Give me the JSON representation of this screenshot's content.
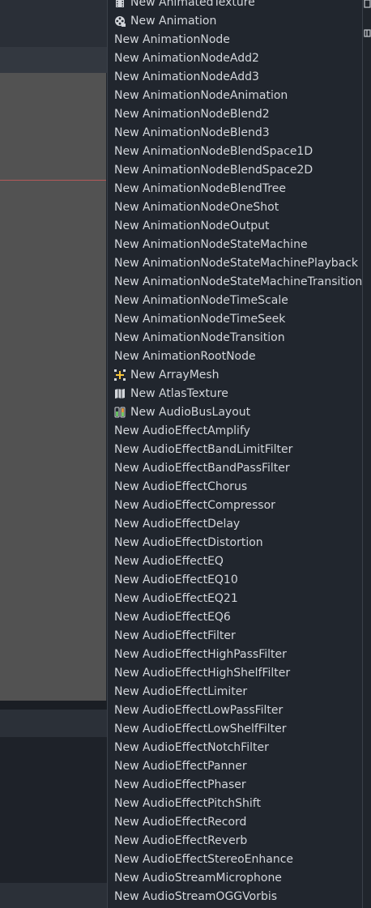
{
  "menu": {
    "items": [
      {
        "label": "New AnimatedTexture",
        "icon": "film-icon"
      },
      {
        "label": "New Animation",
        "icon": "animation-icon"
      },
      {
        "label": "New AnimationNode",
        "icon": ""
      },
      {
        "label": "New AnimationNodeAdd2",
        "icon": ""
      },
      {
        "label": "New AnimationNodeAdd3",
        "icon": ""
      },
      {
        "label": "New AnimationNodeAnimation",
        "icon": ""
      },
      {
        "label": "New AnimationNodeBlend2",
        "icon": ""
      },
      {
        "label": "New AnimationNodeBlend3",
        "icon": ""
      },
      {
        "label": "New AnimationNodeBlendSpace1D",
        "icon": ""
      },
      {
        "label": "New AnimationNodeBlendSpace2D",
        "icon": ""
      },
      {
        "label": "New AnimationNodeBlendTree",
        "icon": ""
      },
      {
        "label": "New AnimationNodeOneShot",
        "icon": ""
      },
      {
        "label": "New AnimationNodeOutput",
        "icon": ""
      },
      {
        "label": "New AnimationNodeStateMachine",
        "icon": ""
      },
      {
        "label": "New AnimationNodeStateMachinePlayback",
        "icon": ""
      },
      {
        "label": "New AnimationNodeStateMachineTransition",
        "icon": ""
      },
      {
        "label": "New AnimationNodeTimeScale",
        "icon": ""
      },
      {
        "label": "New AnimationNodeTimeSeek",
        "icon": ""
      },
      {
        "label": "New AnimationNodeTransition",
        "icon": ""
      },
      {
        "label": "New AnimationRootNode",
        "icon": ""
      },
      {
        "label": "New ArrayMesh",
        "icon": "array-mesh-icon"
      },
      {
        "label": "New AtlasTexture",
        "icon": "atlas-map-icon"
      },
      {
        "label": "New AudioBusLayout",
        "icon": "audio-bus-icon"
      },
      {
        "label": "New AudioEffectAmplify",
        "icon": ""
      },
      {
        "label": "New AudioEffectBandLimitFilter",
        "icon": ""
      },
      {
        "label": "New AudioEffectBandPassFilter",
        "icon": ""
      },
      {
        "label": "New AudioEffectChorus",
        "icon": ""
      },
      {
        "label": "New AudioEffectCompressor",
        "icon": ""
      },
      {
        "label": "New AudioEffectDelay",
        "icon": ""
      },
      {
        "label": "New AudioEffectDistortion",
        "icon": ""
      },
      {
        "label": "New AudioEffectEQ",
        "icon": ""
      },
      {
        "label": "New AudioEffectEQ10",
        "icon": ""
      },
      {
        "label": "New AudioEffectEQ21",
        "icon": ""
      },
      {
        "label": "New AudioEffectEQ6",
        "icon": ""
      },
      {
        "label": "New AudioEffectFilter",
        "icon": ""
      },
      {
        "label": "New AudioEffectHighPassFilter",
        "icon": ""
      },
      {
        "label": "New AudioEffectHighShelfFilter",
        "icon": ""
      },
      {
        "label": "New AudioEffectLimiter",
        "icon": ""
      },
      {
        "label": "New AudioEffectLowPassFilter",
        "icon": ""
      },
      {
        "label": "New AudioEffectLowShelfFilter",
        "icon": ""
      },
      {
        "label": "New AudioEffectNotchFilter",
        "icon": ""
      },
      {
        "label": "New AudioEffectPanner",
        "icon": ""
      },
      {
        "label": "New AudioEffectPhaser",
        "icon": ""
      },
      {
        "label": "New AudioEffectPitchShift",
        "icon": ""
      },
      {
        "label": "New AudioEffectRecord",
        "icon": ""
      },
      {
        "label": "New AudioEffectReverb",
        "icon": ""
      },
      {
        "label": "New AudioEffectStereoEnhance",
        "icon": ""
      },
      {
        "label": "New AudioStreamMicrophone",
        "icon": ""
      },
      {
        "label": "New AudioStreamOGGVorbis",
        "icon": ""
      }
    ]
  },
  "colors": {
    "menu_bg": "#21262e",
    "menu_text": "#d3d6db",
    "viewport_bg": "#525252",
    "guide_line": "#b35a5a",
    "array_mesh_accent": "#f5c43b",
    "audio_bus_green": "#6fd16a",
    "audio_bus_orange": "#f5a13b"
  },
  "editor": {
    "right_icon": "dock-icon"
  }
}
